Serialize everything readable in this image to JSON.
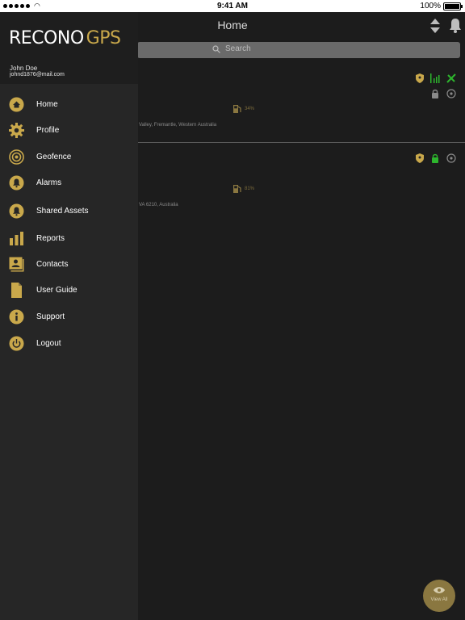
{
  "status_bar": {
    "time": "9:41 AM",
    "battery": "100%"
  },
  "nav": {
    "title": "Home"
  },
  "search": {
    "placeholder": "Search"
  },
  "assets": [
    {
      "fuel": "34%",
      "address": "Valley, Fremantle, Western Australia"
    },
    {
      "fuel": "81%",
      "address": "VA 6210, Australia"
    }
  ],
  "fab": {
    "label": "View All"
  },
  "drawer": {
    "logo": {
      "main": "RECONO",
      "accent": "GPS"
    },
    "user": {
      "name": "John Doe",
      "email": "johnd1876@mail.com"
    },
    "menu": [
      {
        "label": "Home",
        "icon": "home-icon"
      },
      {
        "label": "Profile",
        "icon": "gear-icon"
      },
      {
        "label": "Geofence",
        "icon": "geofence-icon"
      },
      {
        "label": "Alarms",
        "icon": "bell-icon"
      },
      {
        "label": "Shared Assets",
        "icon": "shared-bell-icon"
      },
      {
        "label": "Reports",
        "icon": "bar-chart-icon"
      },
      {
        "label": "Contacts",
        "icon": "contacts-icon"
      },
      {
        "label": "User Guide",
        "icon": "document-icon"
      },
      {
        "label": "Support",
        "icon": "info-icon"
      },
      {
        "label": "Logout",
        "icon": "power-icon"
      }
    ]
  },
  "colors": {
    "accent": "#c9a84b",
    "drawer_bg": "#262626",
    "main_bg": "#1c1c1c",
    "green": "#2db52d"
  }
}
